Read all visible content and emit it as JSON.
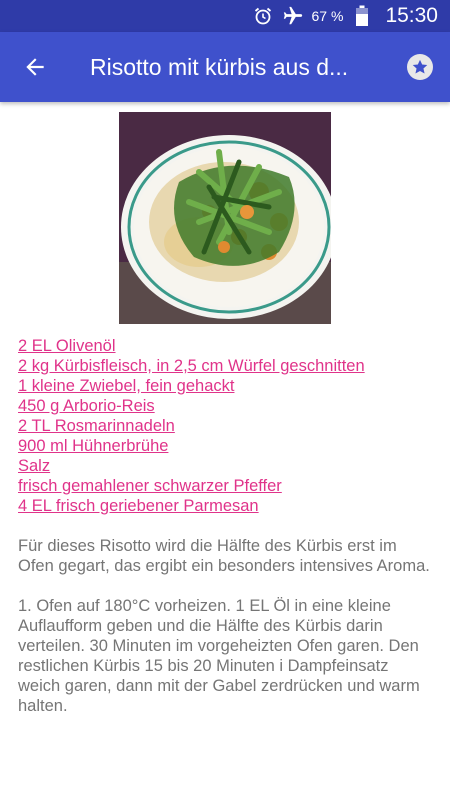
{
  "status_bar": {
    "battery_text": "67 %",
    "clock": "15:30",
    "icons": [
      "alarm-icon",
      "airplane-mode-icon",
      "battery-icon"
    ]
  },
  "app_bar": {
    "title": "Risotto mit kürbis aus d...",
    "back_icon": "arrow-back-icon",
    "favorite_icon": "star-icon",
    "background": "#3f51cc",
    "status_background": "#2f3ba8"
  },
  "recipe": {
    "image_icon": "risotto-photo",
    "ingredients": [
      "2 EL Olivenöl",
      "2 kg Kürbisfleisch, in 2,5 cm Würfel geschnitten",
      "1 kleine Zwiebel, fein gehackt",
      "450 g Arborio-Reis",
      "2 TL Rosmarinnadeln",
      "900 ml Hühnerbrühe",
      "Salz",
      "frisch gemahlener schwarzer Pfeffer",
      "4 EL frisch geriebener Parmesan"
    ],
    "intro": "Für dieses Risotto wird die Hälfte des Kürbis erst im Ofen gegart, das ergibt ein besonders intensives Aroma.",
    "step1": "1. Ofen auf 180°C vorheizen. 1 EL Öl in eine kleine Auflaufform geben und die Hälfte des Kürbis darin verteilen. 30 Minuten im vorgeheizten Ofen garen. Den restlichen Kürbis 15 bis 20 Minuten i Dampfeinsatz weich garen, dann mit der Gabel zerdrücken und warm halten."
  },
  "colors": {
    "link": "#e0338a",
    "body_text": "#757575"
  }
}
